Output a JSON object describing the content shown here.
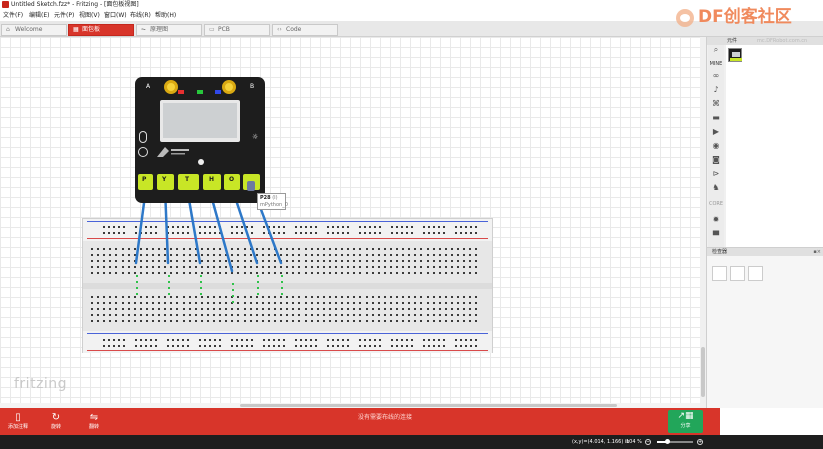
{
  "window": {
    "title": "Untitled Sketch.fzz* - Fritzing - [面包板视图]"
  },
  "menu": [
    "文件(F)",
    "编辑(E)",
    "元件(P)",
    "视图(V)",
    "窗口(W)",
    "布线(R)",
    "帮助(H)"
  ],
  "tabs": [
    {
      "label": "Welcome",
      "icon": "house-icon",
      "active": false
    },
    {
      "label": "面包板",
      "icon": "breadboard-icon",
      "active": true
    },
    {
      "label": "原理图",
      "icon": "schematic-icon",
      "active": false
    },
    {
      "label": "PCB",
      "icon": "pcb-icon",
      "active": false
    },
    {
      "label": "Code",
      "icon": "code-icon",
      "active": false
    }
  ],
  "canvas": {
    "watermark": "fritzing"
  },
  "board": {
    "button_a": "A",
    "button_b": "B",
    "pad_labels": [
      "P",
      "Y",
      "T",
      "H",
      "O",
      "N"
    ]
  },
  "tooltip": {
    "pin": "P28",
    "pin_suffix": "(I)",
    "part": "mPython_0"
  },
  "parts_bin": {
    "title": "元件",
    "mine_label": "MINE",
    "core_label": "CORE"
  },
  "inspector": {
    "title": "检查器"
  },
  "bottom_toolbar": {
    "add_note": "添加注释",
    "rotate": "旋转",
    "flip": "翻转",
    "routing_status": "没有需要布线的连接",
    "share": "分享"
  },
  "status": {
    "coords": "(x,y)=(4.014, 1.166) in",
    "zoom": "104 %",
    "zoom_fraction": 0.3
  },
  "brand": {
    "logo_text": "DF创客社区",
    "site_text": "mc.DFRobot.com.cn"
  },
  "colors": {
    "accent": "#d8352a",
    "share": "#22a65a",
    "wire": "#2d78c8",
    "pad": "#c8e626"
  }
}
